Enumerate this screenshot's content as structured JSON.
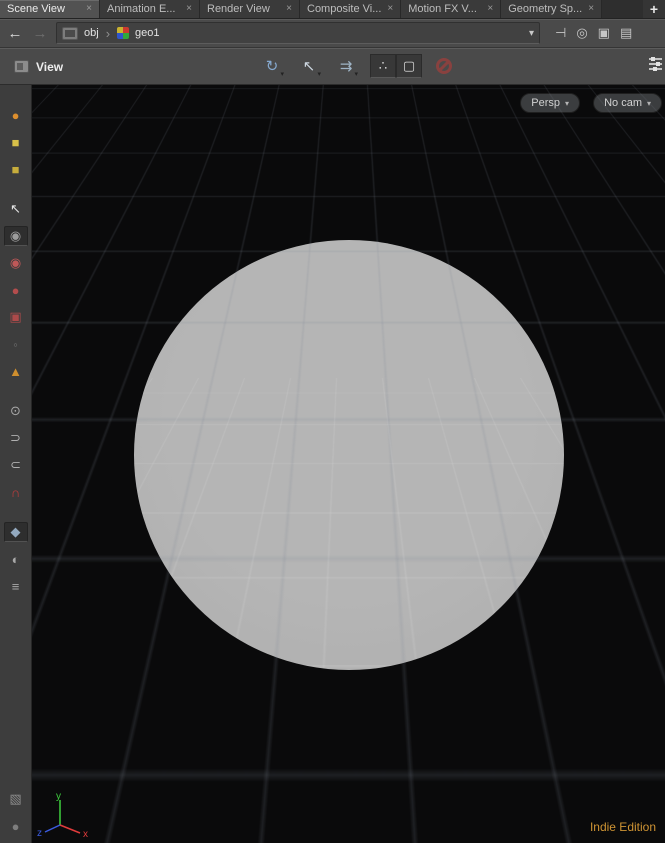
{
  "tab_bar": {
    "add_button": "+",
    "tabs": [
      {
        "label": "Scene View",
        "close": "×",
        "active": true
      },
      {
        "label": "Animation E...",
        "close": "×",
        "active": false
      },
      {
        "label": "Render View",
        "close": "×",
        "active": false
      },
      {
        "label": "Composite Vi...",
        "close": "×",
        "active": false
      },
      {
        "label": "Motion FX V...",
        "close": "×",
        "active": false
      },
      {
        "label": "Geometry Sp...",
        "close": "×",
        "active": false
      }
    ]
  },
  "nav_bar": {
    "back_arrow": "←",
    "forward_arrow": "→",
    "path": {
      "root": "obj",
      "separator": "›",
      "node": "geo1"
    },
    "dropdown_caret": "▾",
    "icons": {
      "pin": "⊣",
      "target": "◎",
      "panel": "▣",
      "layout": "▤"
    }
  },
  "view_toolbar": {
    "title": "View",
    "tools": [
      {
        "glyph": "↻",
        "caret": "▾",
        "color": "#86a9cf"
      },
      {
        "glyph": "↖",
        "caret": "▾",
        "color": "#cdd7e0"
      },
      {
        "glyph": "⇉",
        "caret": "▾",
        "color": "#9fb4c6"
      }
    ],
    "toggles": [
      {
        "glyph": "∴",
        "color": "#d8d8d8"
      },
      {
        "glyph": "▢",
        "color": "#d8d8d8"
      }
    ]
  },
  "left_toolbar": {
    "items": [
      {
        "glyph": "●",
        "color": "#dd8f2e"
      },
      {
        "glyph": "■",
        "color": "#d8c049"
      },
      {
        "glyph": "■",
        "color": "#c7ad3c"
      },
      {
        "glyph": "↖",
        "color": "#e4e4e4"
      },
      {
        "glyph": "◉",
        "color": "#9c9c9c"
      },
      {
        "glyph": "◉",
        "color": "#c05858"
      },
      {
        "glyph": "●",
        "color": "#b34d4d"
      },
      {
        "glyph": "▣",
        "color": "#ad4a4a"
      },
      {
        "glyph": "◦",
        "color": "#6f6f6f"
      },
      {
        "glyph": "▲",
        "color": "#cf8f2e"
      },
      {
        "glyph": "⊙",
        "color": "#a8a8a8"
      },
      {
        "glyph": "⊃",
        "color": "#b0b0b0"
      },
      {
        "glyph": "⊂",
        "color": "#b0b0b0"
      },
      {
        "glyph": "∩",
        "color": "#c23b3b"
      },
      {
        "glyph": "◆",
        "color": "#93a9bf"
      },
      {
        "glyph": "◐",
        "color": "#a8a8a8"
      },
      {
        "glyph": "≡",
        "color": "#a8a8a8"
      },
      {
        "glyph": "▧",
        "color": "#8d8d8d"
      },
      {
        "glyph": "●",
        "color": "#7d7d7d"
      }
    ]
  },
  "viewport": {
    "projection_button": {
      "label": "Persp",
      "caret": "▾"
    },
    "camera_button": {
      "label": "No cam",
      "caret": "▾"
    },
    "edition_label": "Indie Edition",
    "axis_labels": {
      "x": "x",
      "y": "y",
      "z": "z"
    },
    "colors": {
      "background": "#0a0a0b",
      "sphere": "#b1b1b1",
      "edition_text": "#cf9434"
    }
  }
}
